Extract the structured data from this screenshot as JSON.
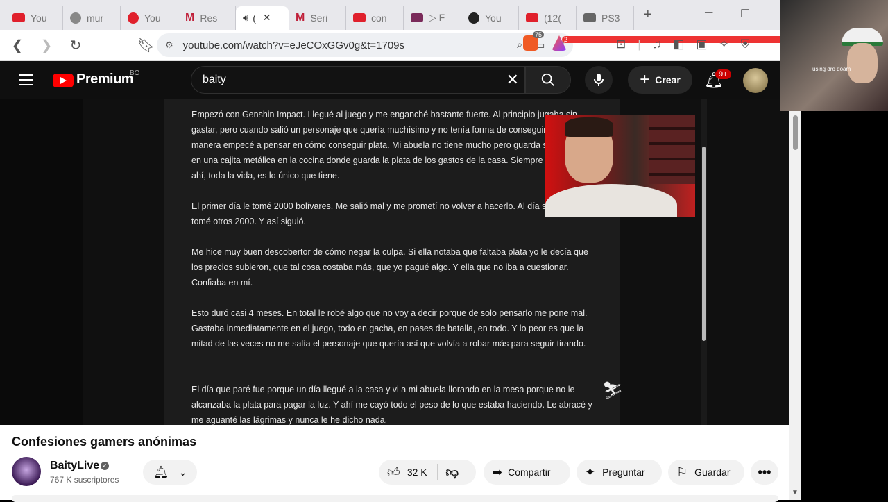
{
  "browser": {
    "tabs": [
      {
        "label": "You",
        "fav": "yt"
      },
      {
        "label": "mur",
        "fav": "globe"
      },
      {
        "label": "You",
        "fav": "circle"
      },
      {
        "label": "Res",
        "fav": "m"
      },
      {
        "label": "(",
        "fav": "audio",
        "active": true
      },
      {
        "label": "Seri",
        "fav": "m"
      },
      {
        "label": "con",
        "fav": "yt"
      },
      {
        "label": "▷ F",
        "fav": "pic"
      },
      {
        "label": "You",
        "fav": "dark"
      },
      {
        "label": "(12(",
        "fav": "yt"
      },
      {
        "label": "PS3",
        "fav": "ps"
      }
    ],
    "url": "youtube.com/watch?v=eJeCOxGGv0g&t=1709s",
    "ext_badge_1": "75",
    "ext_badge_2": "2"
  },
  "youtube": {
    "logo_text": "Premium",
    "country": "BO",
    "search_value": "baity",
    "create_label": "Crear",
    "notif_count": "9+"
  },
  "video": {
    "paragraphs": [
      "Empezó con Genshin Impact. Llegué al juego y me enganché bastante fuerte. Al principio jugaba sin gastar, pero cuando salió un personaje que quería muchísimo y no tenía forma de conseguirlo de otra manera empecé a pensar en cómo conseguir plata. Mi abuela no tiene mucho pero guarda sus ahorros en una cajita metálica en la cocina donde guarda la plata de los gastos de la casa. Siempre la ha tenido ahí, toda la vida, es lo único que tiene.",
      "El primer día le tomé 2000 bolívares. Me salió mal y me prometí no volver a hacerlo. Al día siguiente le tomé otros 2000. Y así siguió.",
      "Me hice muy buen descobertor de cómo negar la culpa. Si ella notaba que faltaba plata yo le decía que los precios subieron, que tal cosa costaba más, que yo pagué algo. Y ella que no iba a cuestionar. Confiaba en mí.",
      "Esto duró casi 4 meses. En total le robé algo que no voy a decir porque de solo pensarlo me pone mal. Gastaba inmediatamente en el juego, todo en gacha, en pases de batalla, en todo. Y lo peor es que la mitad de las veces no me salía el personaje que quería así que volvía a robar más para seguir tirando.",
      "El día que paré fue porque un día llegué a la casa y vi a mi abuela llorando en la mesa porque no le alcanzaba la plata para pagar la luz. Y ahí me cayó todo el peso de lo que estaba haciendo. Le abracé y me aguanté las lágrimas y nunca le he dicho nada."
    ]
  },
  "webcam": {
    "overlay_text": "using dro doam"
  },
  "details": {
    "title": "Confesiones gamers anónimas",
    "channel": "BaityLive",
    "subscribers": "767 K suscriptores",
    "likes": "32 K",
    "share_label": "Compartir",
    "ask_label": "Preguntar",
    "save_label": "Guardar"
  }
}
